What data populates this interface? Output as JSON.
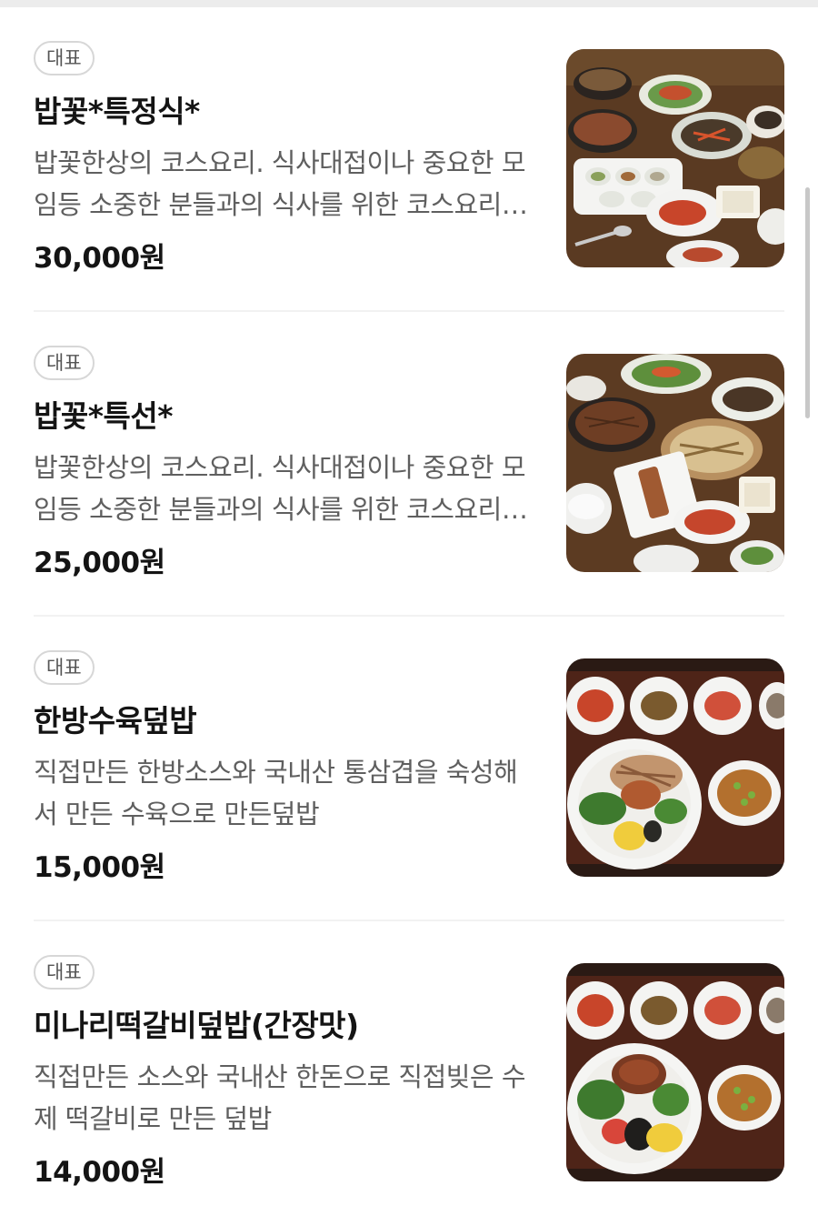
{
  "menu": {
    "items": [
      {
        "badge": "대표",
        "name": "밥꽃*특정식*",
        "description": "밥꽃한상의 코스요리. 식사대접이나 중요한 모임등 소중한 분들과의 식사를 위한 코스요리입니다",
        "price": "30,000원",
        "photo": "korean-table-spread-photo"
      },
      {
        "badge": "대표",
        "name": "밥꽃*특선*",
        "description": "밥꽃한상의 코스요리. 식사대접이나 중요한 모임등 소중한 분들과의 식사를 위한 코스요리입니다",
        "price": "25,000원",
        "photo": "korean-course-spread-photo"
      },
      {
        "badge": "대표",
        "name": "한방수육덮밥",
        "description": "직접만든 한방소스와 국내산 통삼겹을 숙성해서 만든 수육으로 만든덮밥",
        "price": "15,000원",
        "photo": "pork-rice-bowl-photo"
      },
      {
        "badge": "대표",
        "name": "미나리떡갈비덮밥(간장맛)",
        "description": "직접만든 소스와 국내산 한돈으로 직접빚은 수제 떡갈비로 만든 덮밥",
        "price": "14,000원",
        "photo": "tteokgalbi-rice-bowl-photo"
      }
    ]
  },
  "colors": {
    "text_primary": "#141414",
    "text_secondary": "#5f5f5f",
    "badge_border": "#d7d7d7",
    "divider": "#f2f2f2"
  }
}
